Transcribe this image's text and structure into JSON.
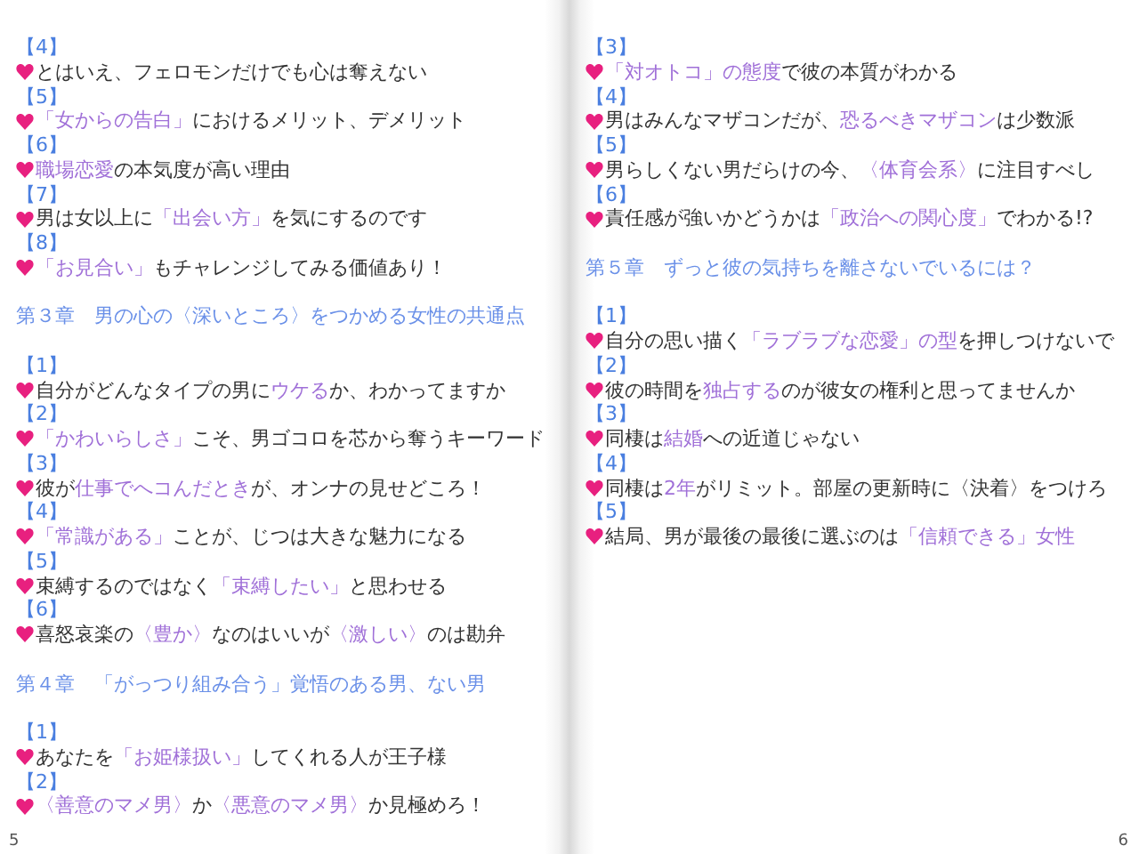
{
  "pages": [
    {
      "page_number": "5",
      "blocks": [
        {
          "kind": "number",
          "text": "【4】"
        },
        {
          "kind": "item",
          "segments": [
            {
              "text": "とはいえ、フェロモンだけでも心は奪えない",
              "highlight": false
            }
          ]
        },
        {
          "kind": "number",
          "text": "【5】"
        },
        {
          "kind": "item",
          "segments": [
            {
              "text": "「女からの告白」",
              "highlight": true
            },
            {
              "text": "におけるメリット、デメリット",
              "highlight": false
            }
          ]
        },
        {
          "kind": "number",
          "text": "【6】"
        },
        {
          "kind": "item",
          "segments": [
            {
              "text": "職場恋愛",
              "highlight": true
            },
            {
              "text": "の本気度が高い理由",
              "highlight": false
            }
          ]
        },
        {
          "kind": "number",
          "text": "【7】"
        },
        {
          "kind": "item",
          "segments": [
            {
              "text": "男は女以上に",
              "highlight": false
            },
            {
              "text": "「出会い方」",
              "highlight": true
            },
            {
              "text": "を気にするのです",
              "highlight": false
            }
          ]
        },
        {
          "kind": "number",
          "text": "【8】"
        },
        {
          "kind": "item",
          "segments": [
            {
              "text": "「お見合い」",
              "highlight": true
            },
            {
              "text": "もチャレンジしてみる価値あり！",
              "highlight": false
            }
          ]
        },
        {
          "kind": "chapter",
          "text": "第３章　男の心の〈深いところ〉をつかめる女性の共通点"
        },
        {
          "kind": "number",
          "text": "【1】"
        },
        {
          "kind": "item",
          "segments": [
            {
              "text": "自分がどんなタイプの男に",
              "highlight": false
            },
            {
              "text": "ウケる",
              "highlight": true
            },
            {
              "text": "か、わかってますか",
              "highlight": false
            }
          ]
        },
        {
          "kind": "number",
          "text": "【2】"
        },
        {
          "kind": "item",
          "segments": [
            {
              "text": "「かわいらしさ」",
              "highlight": true
            },
            {
              "text": "こそ、男ゴコロを芯から奪うキーワード",
              "highlight": false
            }
          ]
        },
        {
          "kind": "number",
          "text": "【3】"
        },
        {
          "kind": "item",
          "segments": [
            {
              "text": "彼が",
              "highlight": false
            },
            {
              "text": "仕事でへコんだとき",
              "highlight": true
            },
            {
              "text": "が、オンナの見せどころ！",
              "highlight": false
            }
          ]
        },
        {
          "kind": "number",
          "text": "【4】"
        },
        {
          "kind": "item",
          "segments": [
            {
              "text": "「常識がある」",
              "highlight": true
            },
            {
              "text": "ことが、じつは大きな魅力になる",
              "highlight": false
            }
          ]
        },
        {
          "kind": "number",
          "text": "【5】"
        },
        {
          "kind": "item",
          "segments": [
            {
              "text": "束縛するのではなく",
              "highlight": false
            },
            {
              "text": "「束縛したい」",
              "highlight": true
            },
            {
              "text": "と思わせる",
              "highlight": false
            }
          ]
        },
        {
          "kind": "number",
          "text": "【6】"
        },
        {
          "kind": "item",
          "segments": [
            {
              "text": "喜怒哀楽の",
              "highlight": false
            },
            {
              "text": "〈豊か〉",
              "highlight": true
            },
            {
              "text": "なのはいいが",
              "highlight": false
            },
            {
              "text": "〈激しい〉",
              "highlight": true
            },
            {
              "text": "のは勘弁",
              "highlight": false
            }
          ]
        },
        {
          "kind": "chapter",
          "text": "第４章　「がっつり組み合う」覚悟のある男、ない男"
        },
        {
          "kind": "number",
          "text": "【1】"
        },
        {
          "kind": "item",
          "segments": [
            {
              "text": "あなたを",
              "highlight": false
            },
            {
              "text": "「お姫様扱い」",
              "highlight": true
            },
            {
              "text": "してくれる人が王子様",
              "highlight": false
            }
          ]
        },
        {
          "kind": "number",
          "text": "【2】"
        },
        {
          "kind": "item",
          "segments": [
            {
              "text": "〈善意のマメ男〉",
              "highlight": true
            },
            {
              "text": "か",
              "highlight": false
            },
            {
              "text": "〈悪意のマメ男〉",
              "highlight": true
            },
            {
              "text": "か見極めろ！",
              "highlight": false
            }
          ]
        }
      ]
    },
    {
      "page_number": "6",
      "blocks": [
        {
          "kind": "number",
          "text": "【3】"
        },
        {
          "kind": "item",
          "segments": [
            {
              "text": "「対オトコ」の態度",
              "highlight": true
            },
            {
              "text": "で彼の本質がわかる",
              "highlight": false
            }
          ]
        },
        {
          "kind": "number",
          "text": "【4】"
        },
        {
          "kind": "item",
          "segments": [
            {
              "text": "男はみんなマザコンだが、",
              "highlight": false
            },
            {
              "text": "恐るべきマザコン",
              "highlight": true
            },
            {
              "text": "は少数派",
              "highlight": false
            }
          ]
        },
        {
          "kind": "number",
          "text": "【5】"
        },
        {
          "kind": "item",
          "segments": [
            {
              "text": "男らしくない男だらけの今、",
              "highlight": false
            },
            {
              "text": "〈体育会系〉",
              "highlight": true
            },
            {
              "text": "に注目すべし",
              "highlight": false
            }
          ]
        },
        {
          "kind": "number",
          "text": "【6】"
        },
        {
          "kind": "item",
          "segments": [
            {
              "text": "責任感が強いかどうかは",
              "highlight": false
            },
            {
              "text": "「政治への関心度」",
              "highlight": true
            },
            {
              "text": "でわかる!?",
              "highlight": false
            }
          ]
        },
        {
          "kind": "chapter",
          "text": "第５章　ずっと彼の気持ちを離さないでいるには？"
        },
        {
          "kind": "number",
          "text": "【1】"
        },
        {
          "kind": "item",
          "segments": [
            {
              "text": "自分の思い描く",
              "highlight": false
            },
            {
              "text": "「ラブラブな恋愛」の型",
              "highlight": true
            },
            {
              "text": "を押しつけないで",
              "highlight": false
            }
          ]
        },
        {
          "kind": "number",
          "text": "【2】"
        },
        {
          "kind": "item",
          "segments": [
            {
              "text": "彼の時間を",
              "highlight": false
            },
            {
              "text": "独占する",
              "highlight": true
            },
            {
              "text": "のが彼女の権利と思ってませんか",
              "highlight": false
            }
          ]
        },
        {
          "kind": "number",
          "text": "【3】"
        },
        {
          "kind": "item",
          "segments": [
            {
              "text": "同棲は",
              "highlight": false
            },
            {
              "text": "結婚",
              "highlight": true
            },
            {
              "text": "への近道じゃない",
              "highlight": false
            }
          ]
        },
        {
          "kind": "number",
          "text": "【4】"
        },
        {
          "kind": "item",
          "segments": [
            {
              "text": "同棲は",
              "highlight": false
            },
            {
              "text": "2年",
              "highlight": true
            },
            {
              "text": "がリミット。部屋の更新時に〈決着〉をつけろ",
              "highlight": false
            }
          ]
        },
        {
          "kind": "number",
          "text": "【5】"
        },
        {
          "kind": "item",
          "segments": [
            {
              "text": "結局、男が最後の最後に選ぶのは",
              "highlight": false
            },
            {
              "text": "「信頼できる」女性",
              "highlight": true
            }
          ]
        }
      ]
    }
  ]
}
